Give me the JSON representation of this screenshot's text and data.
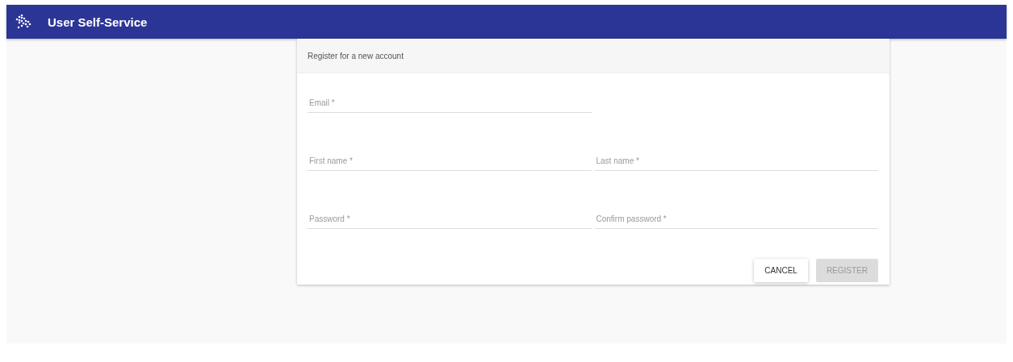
{
  "app_bar": {
    "title": "User Self-Service"
  },
  "card": {
    "title": "Register for a new account",
    "rows": [
      [
        {
          "placeholder": "Email *"
        }
      ],
      [
        {
          "placeholder": "First name *"
        },
        {
          "placeholder": "Last name *"
        }
      ],
      [
        {
          "placeholder": "Password *"
        },
        {
          "placeholder": "Confirm password *"
        }
      ]
    ],
    "buttons": [
      {
        "label": "CANCEL",
        "disabled": false
      },
      {
        "label": "REGISTER",
        "disabled": true
      }
    ]
  }
}
